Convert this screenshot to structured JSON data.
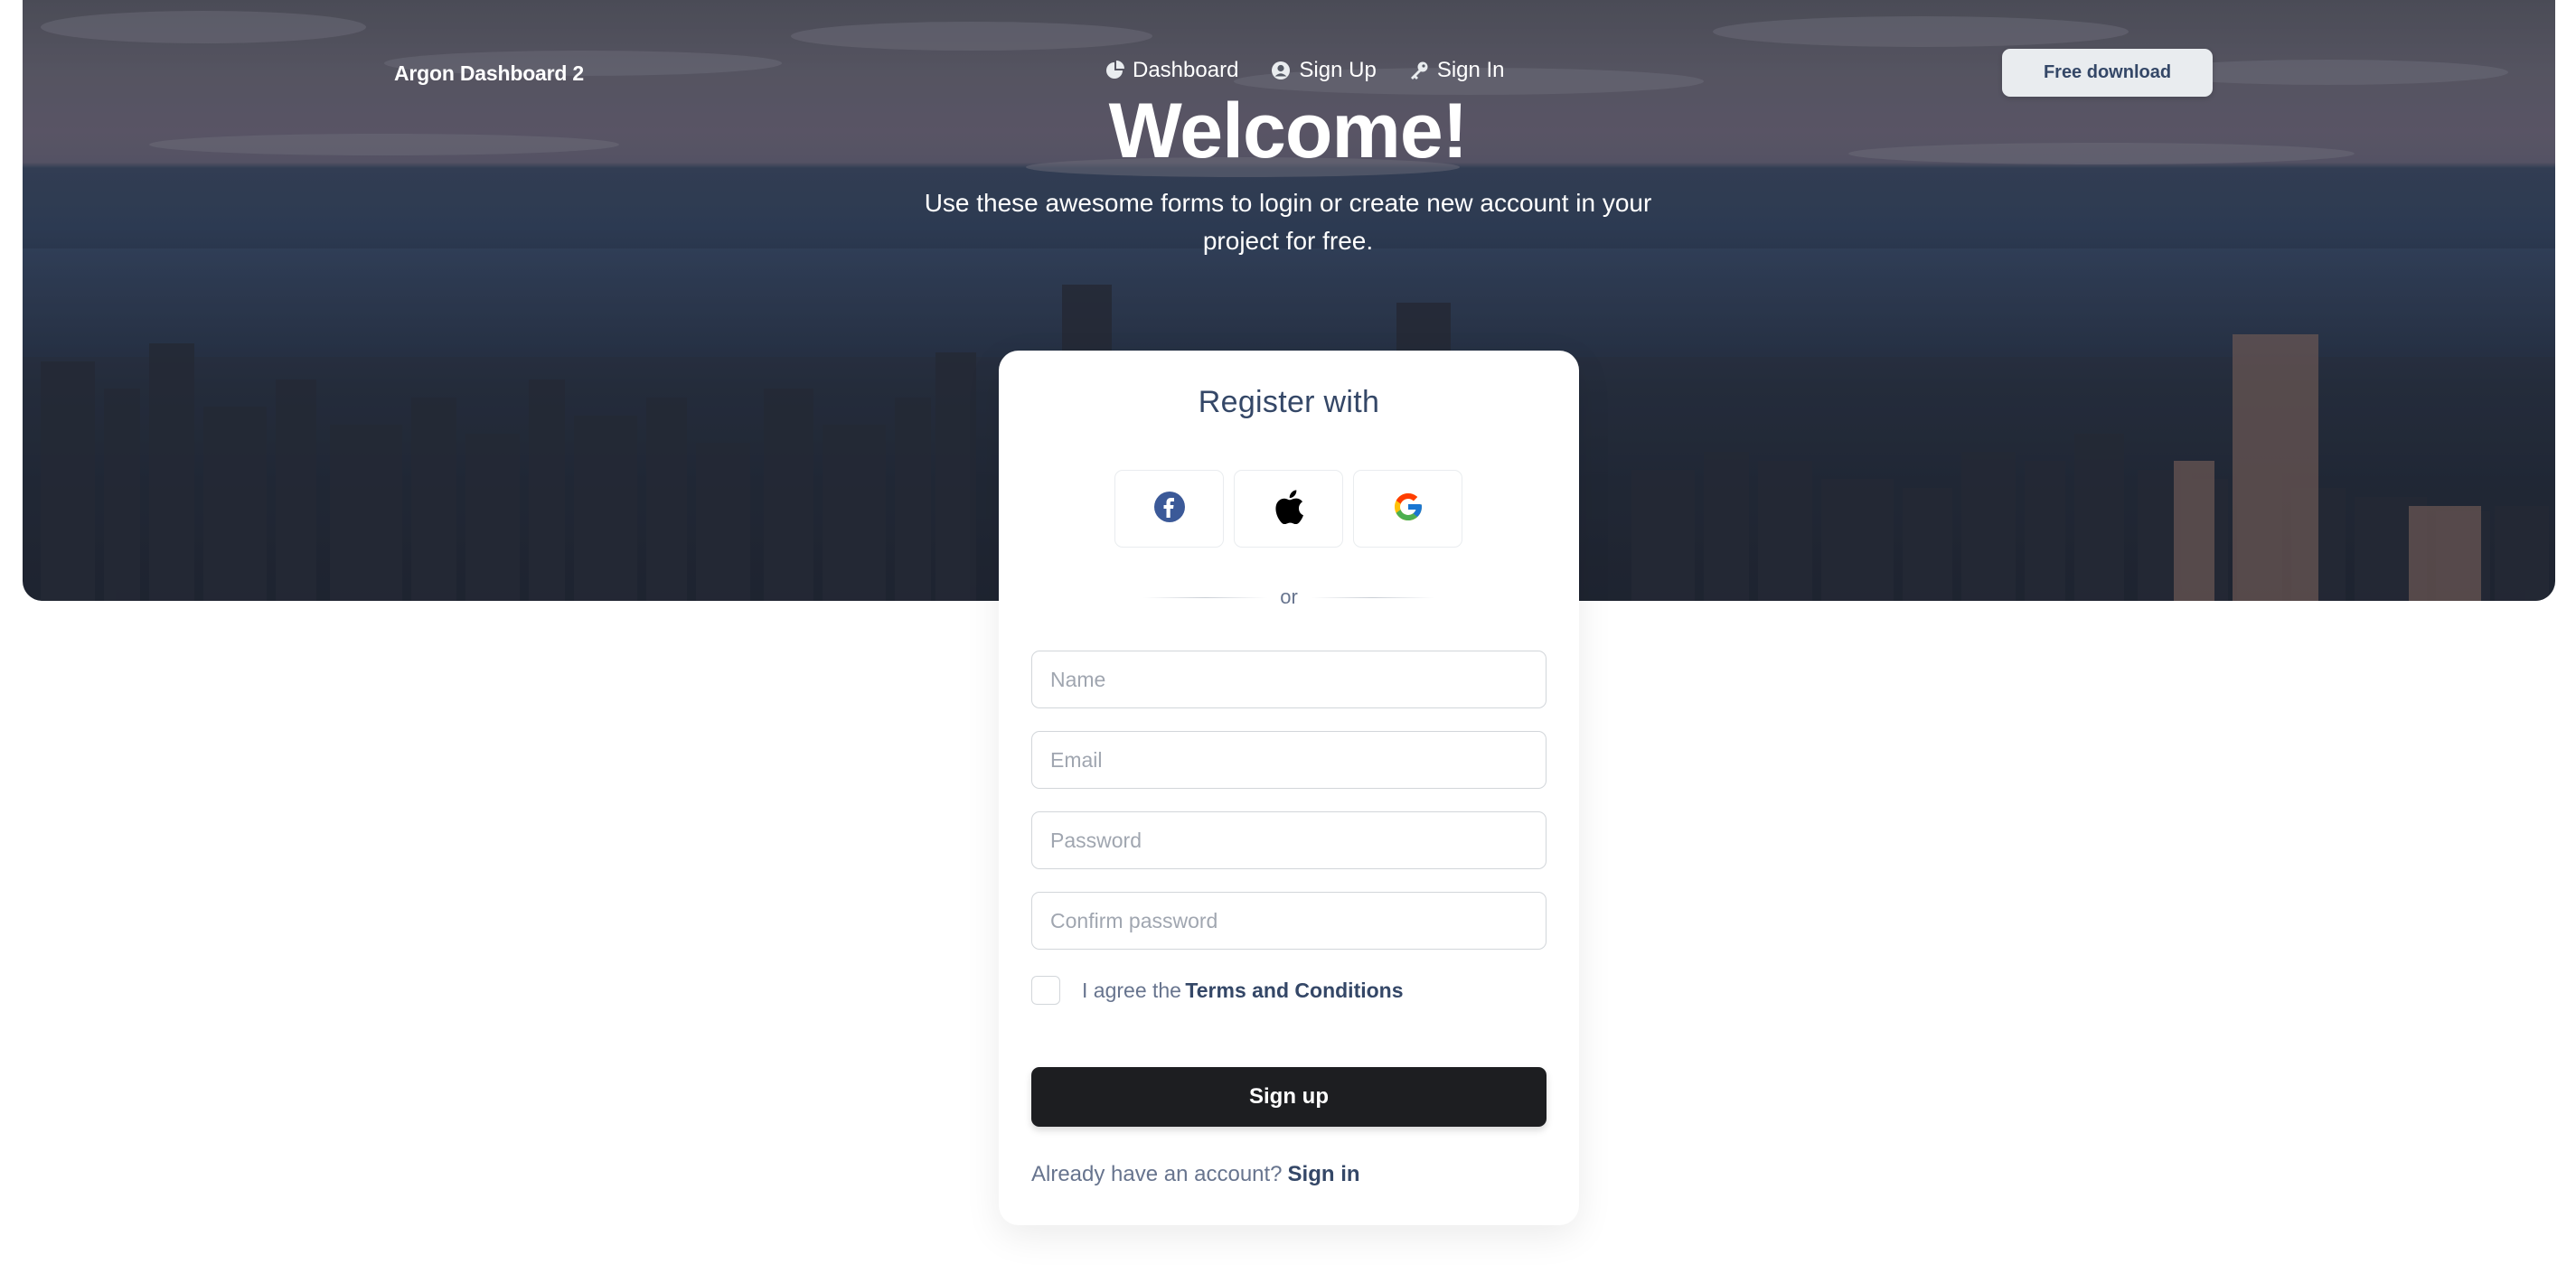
{
  "nav": {
    "brand": "Argon Dashboard 2",
    "links": [
      {
        "label": "Dashboard",
        "icon": "chart-pie-icon"
      },
      {
        "label": "Sign Up",
        "icon": "user-circle-icon"
      },
      {
        "label": "Sign In",
        "icon": "key-icon"
      }
    ],
    "cta": "Free download"
  },
  "hero": {
    "title": "Welcome!",
    "subtitle": "Use these awesome forms to login or create new account in your project for free."
  },
  "card": {
    "title": "Register with",
    "social": [
      {
        "icon": "facebook-icon"
      },
      {
        "icon": "apple-icon"
      },
      {
        "icon": "google-icon"
      }
    ],
    "divider": "or",
    "fields": {
      "name_placeholder": "Name",
      "email_placeholder": "Email",
      "password_placeholder": "Password",
      "confirm_placeholder": "Confirm password"
    },
    "terms_prefix": "I agree the",
    "terms_link": "Terms and Conditions",
    "submit": "Sign up",
    "footer_text": "Already have an account?",
    "footer_link": "Sign in"
  },
  "colors": {
    "primary_text": "#344767",
    "secondary_text": "#67748e",
    "button_dark": "#1d1e21",
    "facebook": "#3b5998"
  }
}
